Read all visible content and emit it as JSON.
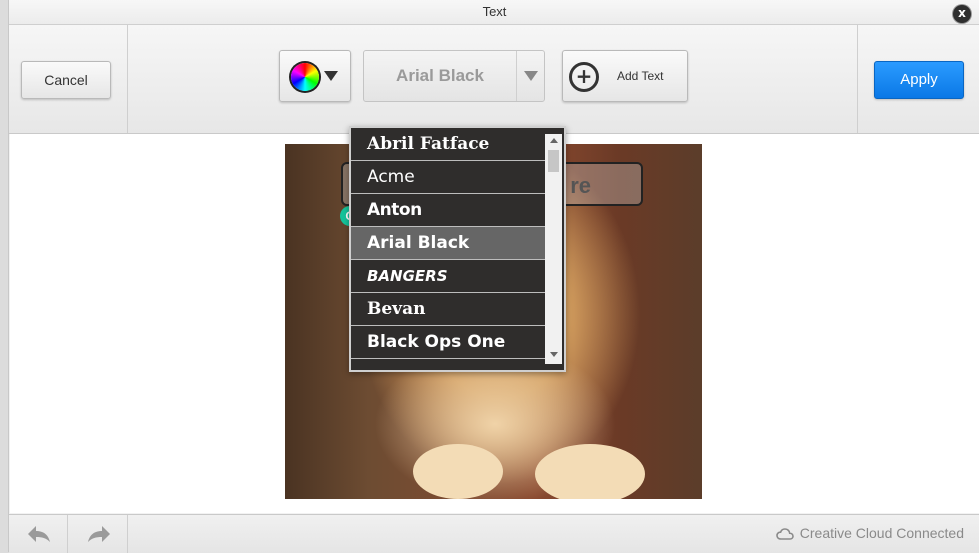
{
  "dialog": {
    "title": "Text",
    "close_label": "x"
  },
  "toolbar": {
    "cancel_label": "Cancel",
    "color_icon": "color-wheel-icon",
    "font_select_value": "Arial Black",
    "add_text_label": "Add Text",
    "apply_label": "Apply",
    "apply_color": "#0a78e6"
  },
  "canvas": {
    "text_overlay_value": "re"
  },
  "font_dropdown": {
    "items": [
      "Abril Fatface",
      "Acme",
      "Anton",
      "Arial Black",
      "BANGERS",
      "Bevan",
      "Black Ops One"
    ],
    "selected": "Arial Black"
  },
  "footer": {
    "status_text": "Creative Cloud Connected"
  }
}
